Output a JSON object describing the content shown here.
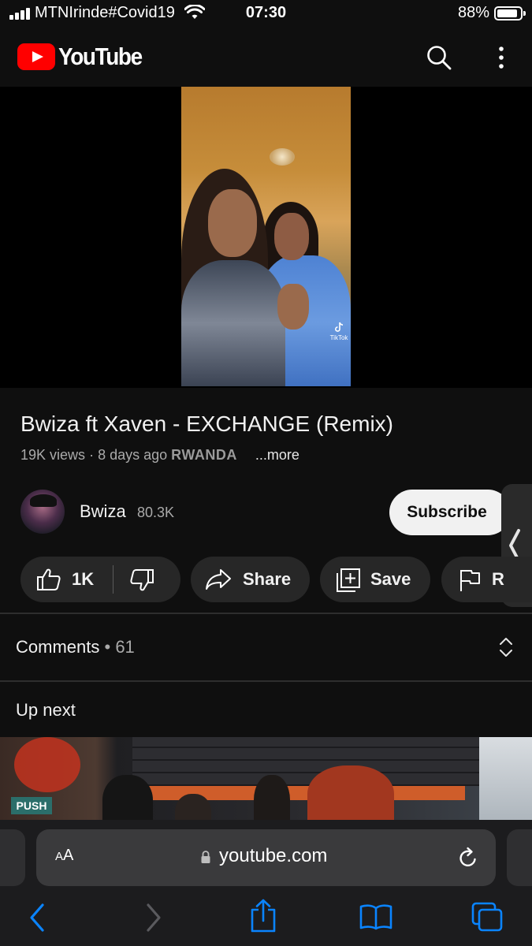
{
  "status_bar": {
    "carrier": "MTNIrinde#Covid19",
    "time": "07:30",
    "battery_percent": "88%",
    "battery_level": 0.88,
    "signal_bars": 4
  },
  "header": {
    "logo_text": "YouTube",
    "icons": [
      "search-icon",
      "more-vertical-icon"
    ]
  },
  "video": {
    "title": "Bwiza ft Xaven - EXCHANGE (Remix)",
    "views": "19K views",
    "separator": "·",
    "age": "8 days ago",
    "hashtag": "RWANDA",
    "more_label": "...more",
    "watermark": "TikTok"
  },
  "channel": {
    "name": "Bwiza",
    "subscribers": "80.3K",
    "subscribe_label": "Subscribe"
  },
  "actions": {
    "like_count": "1K",
    "share_label": "Share",
    "save_label": "Save",
    "report_label_partial": "R"
  },
  "comments": {
    "label": "Comments",
    "dot": "•",
    "count": "61"
  },
  "up_next": {
    "label": "Up next",
    "thumbnail_sign": "PUSH"
  },
  "safari": {
    "aa_label_small": "A",
    "aa_label_large": "A",
    "url": "youtube.com",
    "toolbar": [
      "back-icon",
      "forward-icon",
      "share-icon",
      "bookmarks-icon",
      "tabs-icon"
    ]
  },
  "colors": {
    "background": "#0f0f0f",
    "youtube_red": "#ff0000",
    "pill_background": "#272727",
    "subscribe_background": "#f1f1f1",
    "safari_accent": "#0a84ff"
  }
}
